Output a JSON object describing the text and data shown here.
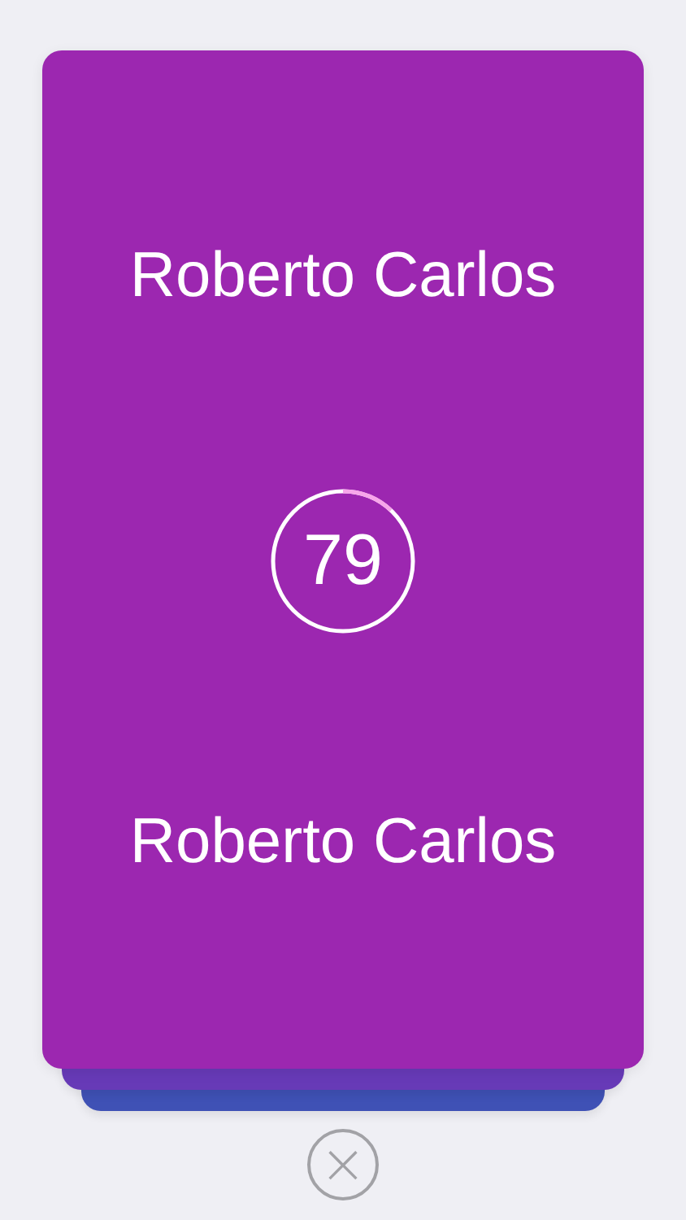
{
  "card": {
    "color": "#9c27b0",
    "top_name": "Roberto Carlos",
    "score": "79",
    "timer": {
      "level": 0.12
    },
    "bottom_name": "Roberto Carlos"
  },
  "stack": [
    {
      "color": "#673ab7"
    },
    {
      "color": "#3f51b5"
    }
  ],
  "close_button": {
    "label": "×"
  }
}
